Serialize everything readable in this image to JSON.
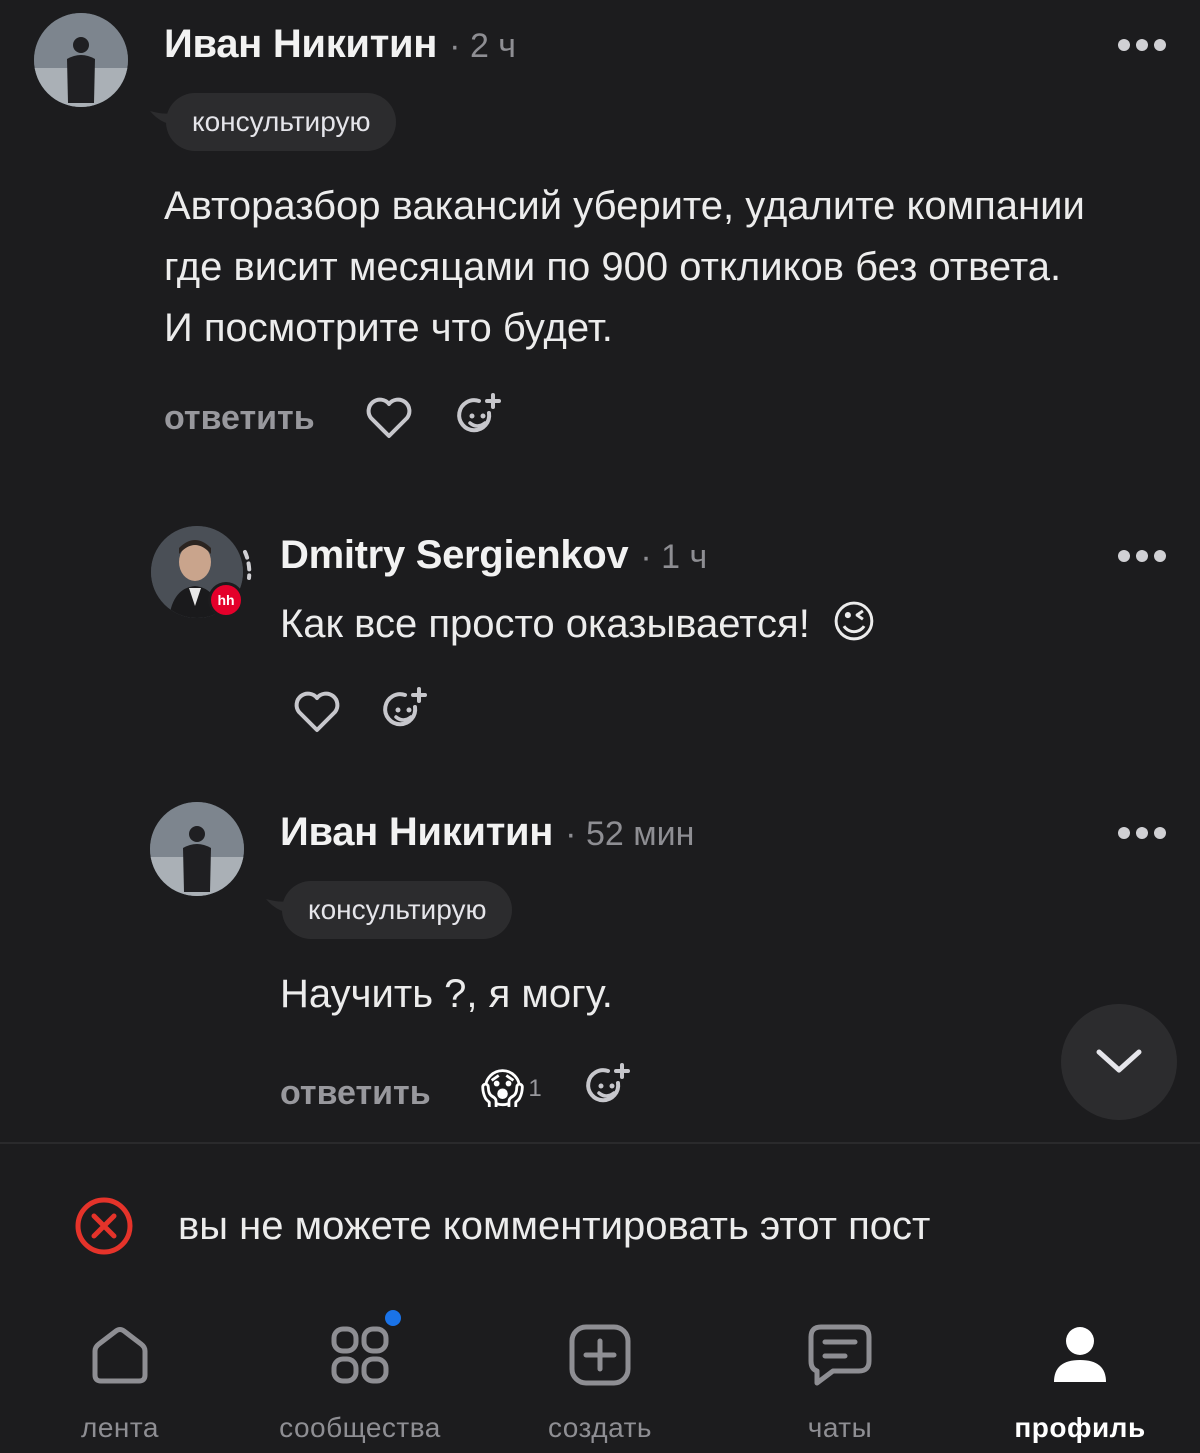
{
  "comments": [
    {
      "author": "Иван Никитин",
      "time": "· 2 ч",
      "badge": "консультирую",
      "text_lines": [
        "Авторазбор вакансий уберите, удалите компании",
        "где висит месяцами по 900 откликов без ответа.",
        "И посмотрите что будет."
      ],
      "reply_label": "ответить"
    },
    {
      "author": "Dmitry Sergienkov",
      "time": "· 1 ч",
      "text": "Как все просто оказывается!",
      "emoji": "😉",
      "avatar_badge": "hh"
    },
    {
      "author": "Иван Никитин",
      "time": "· 52 мин",
      "badge": "консультирую",
      "text": "Научить ?, я могу.",
      "reply_label": "ответить",
      "reaction": {
        "emoji": "😱",
        "count": "1"
      }
    }
  ],
  "notice": {
    "text": "вы не можете комментировать этот пост",
    "icon": "error-circle-icon",
    "color": "#e5332a"
  },
  "tabbar": {
    "items": [
      {
        "label": "лента",
        "icon": "home-icon"
      },
      {
        "label": "сообщества",
        "icon": "grid-icon"
      },
      {
        "label": "создать",
        "icon": "plus-square-icon"
      },
      {
        "label": "чаты",
        "icon": "chat-icon"
      },
      {
        "label": "профиль",
        "icon": "person-icon"
      }
    ],
    "active": "профиль"
  },
  "colors": {
    "background": "#1c1c1e",
    "secondary_text": "#8e8e93",
    "notification_dot": "#1a73e8"
  }
}
